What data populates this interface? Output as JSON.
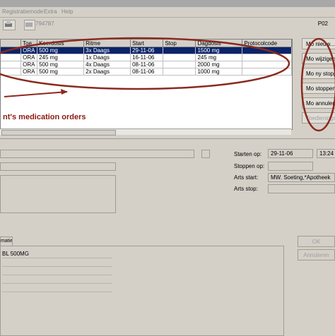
{
  "menu": {
    "items": [
      "Registratiemode",
      "Extra",
      "Help"
    ]
  },
  "toolbar": {
    "id_value": "794787"
  },
  "patient_code": "P02",
  "grid": {
    "columns": [
      "Toe",
      "Keerdosis",
      "Ritme",
      "Start",
      "Stop",
      "Dagdosis",
      "Protocolcode"
    ],
    "rows": [
      [
        "ORA",
        "500 mg",
        "3x Daags",
        "29-11-06",
        "",
        "1500 mg",
        ""
      ],
      [
        "ORA",
        "245 mg",
        "1x Daags",
        "16-11-06",
        "",
        "245 mg",
        ""
      ],
      [
        "ORA",
        "500 mg",
        "4x Daags",
        "08-11-06",
        "",
        "2000 mg",
        ""
      ],
      [
        "ORA",
        "500 mg",
        "2x Daags",
        "08-11-06",
        "",
        "1000 mg",
        ""
      ]
    ]
  },
  "side_buttons": [
    "Mo nieuw...",
    "Mo wijzigen",
    "Mo ny stoppen",
    "Mo stoppen",
    "Mo annuleren",
    "Toedieningsreg"
  ],
  "annotation": "nt's medication orders",
  "details": {
    "start_label": "Starten op:",
    "start_date": "29-11-06",
    "start_time": "13:24",
    "stop_label": "Stoppen op:",
    "arts_start_label": "Arts start:",
    "arts_start_value": "MW. Soeting,*Apotheek",
    "arts_stop_label": "Arts stop:"
  },
  "tab_label": "matie",
  "list_item": "BL 500MG",
  "ok_label": "OK",
  "cancel_label": "Annuleren"
}
